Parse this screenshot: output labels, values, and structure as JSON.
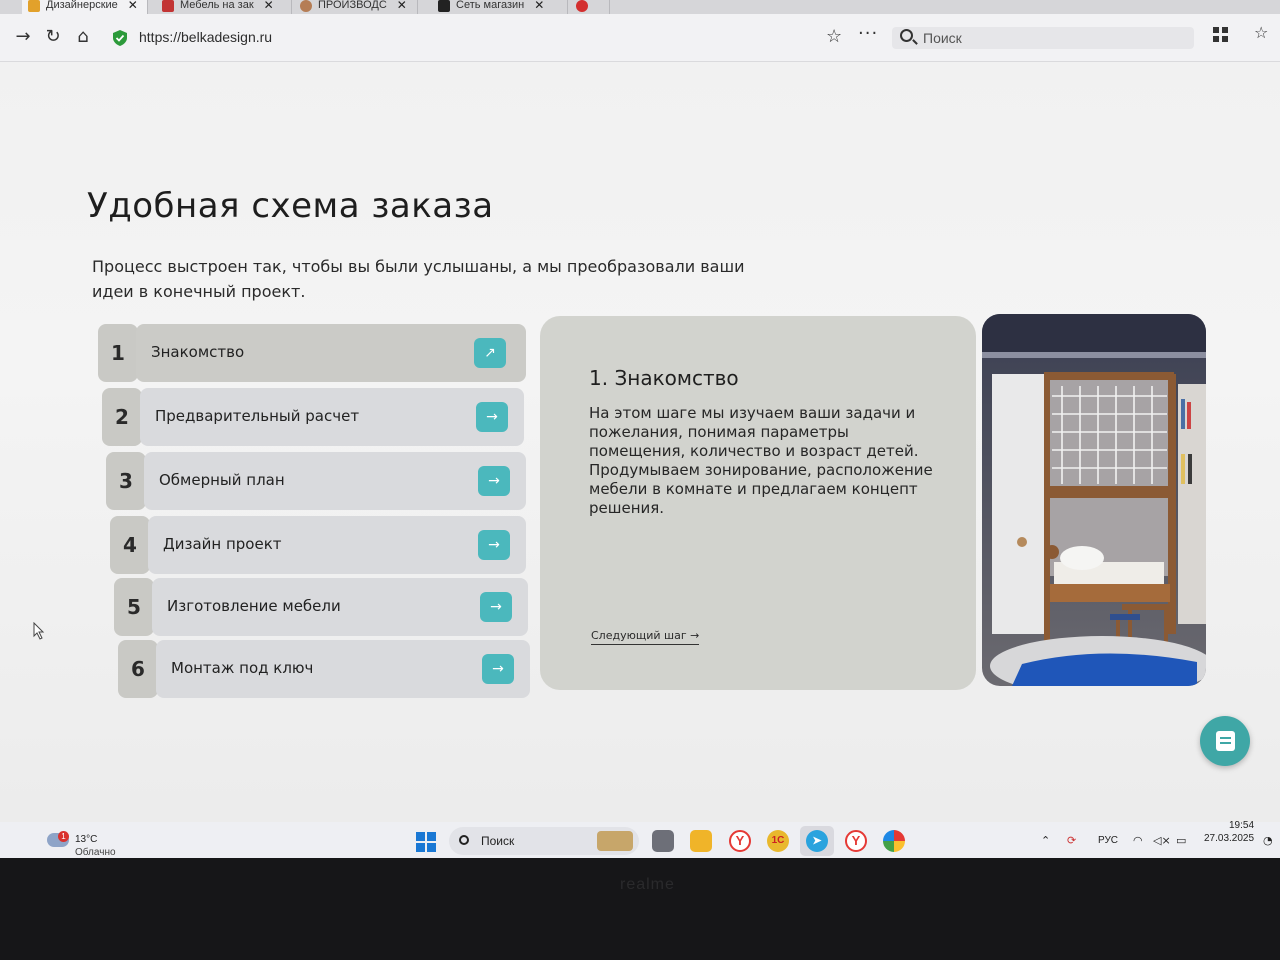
{
  "browser": {
    "tabs": [
      {
        "label": "Дизайнерские",
        "active": true
      },
      {
        "label": "Мебель на зак",
        "active": false
      },
      {
        "label": "ПРОИЗВОДС",
        "active": false
      },
      {
        "label": "Сеть магазин",
        "active": false
      }
    ],
    "url": "https://belkadesign.ru",
    "search_placeholder": "Поиск"
  },
  "page": {
    "title": "Удобная схема заказа",
    "intro": "Процесс выстроен так, чтобы вы были услышаны, а мы преобразовали ваши идеи в конечный проект.",
    "steps": [
      {
        "number": "1",
        "label": "Знакомство",
        "arrow": "↗",
        "active": true
      },
      {
        "number": "2",
        "label": "Предварительный расчет",
        "arrow": "→",
        "active": false
      },
      {
        "number": "3",
        "label": "Обмерный план",
        "arrow": "→",
        "active": false
      },
      {
        "number": "4",
        "label": "Дизайн проект",
        "arrow": "→",
        "active": false
      },
      {
        "number": "5",
        "label": "Изготовление мебели",
        "arrow": "→",
        "active": false
      },
      {
        "number": "6",
        "label": "Монтаж под ключ",
        "arrow": "→",
        "active": false
      }
    ],
    "detail": {
      "title": "1. Знакомство",
      "text": "На этом шаге мы изучаем ваши задачи и пожелания, понимая параметры помещения, количество и возраст детей.\nПродумываем зонирование, расположение мебели в комнате и предлагаем концепт решения.",
      "next_link": "Следующий шаг",
      "next_arrow": "→"
    },
    "accent_color": "#4bb8bd"
  },
  "taskbar": {
    "weather_temp": "13°C",
    "weather_desc": "Облачно",
    "weather_badge": "1",
    "search_placeholder": "Поиск",
    "language": "РУС",
    "time": "19:54",
    "date": "27.03.2025"
  },
  "device": {
    "brand": "realme"
  }
}
